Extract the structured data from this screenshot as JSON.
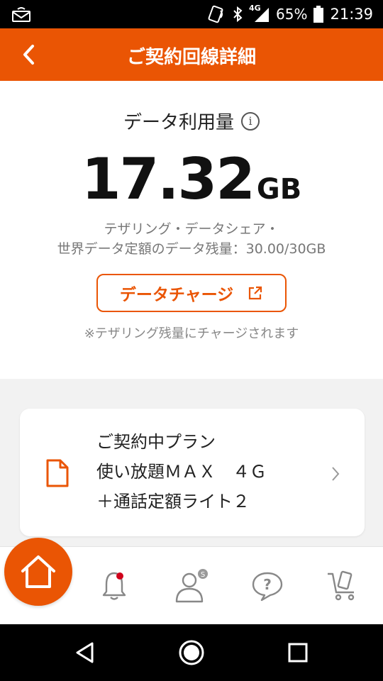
{
  "status_bar": {
    "network": "4G",
    "battery": "65%",
    "time": "21:39"
  },
  "app_bar": {
    "title": "ご契約回線詳細",
    "back_icon": "chevron-left-icon"
  },
  "data_usage": {
    "label": "データ利用量",
    "amount": "17.32",
    "unit": "GB",
    "sub_line1": "テザリング・データシェア・",
    "sub_line2": "世界データ定額のデータ残量：30.00/30GB",
    "charge_button": "データチャージ",
    "charge_note": "※テザリング残量にチャージされます"
  },
  "plan": {
    "line1": "ご契約中プラン",
    "line2": "使い放題ＭＡＸ　４Ｇ",
    "line3": "＋通話定額ライト２"
  },
  "bottom_nav": {
    "items": [
      "home-icon",
      "bell-icon",
      "user-icon",
      "help-icon",
      "cart-icon"
    ]
  },
  "colors": {
    "brand": "#ea5504",
    "notification_dot": "#d0021b"
  }
}
